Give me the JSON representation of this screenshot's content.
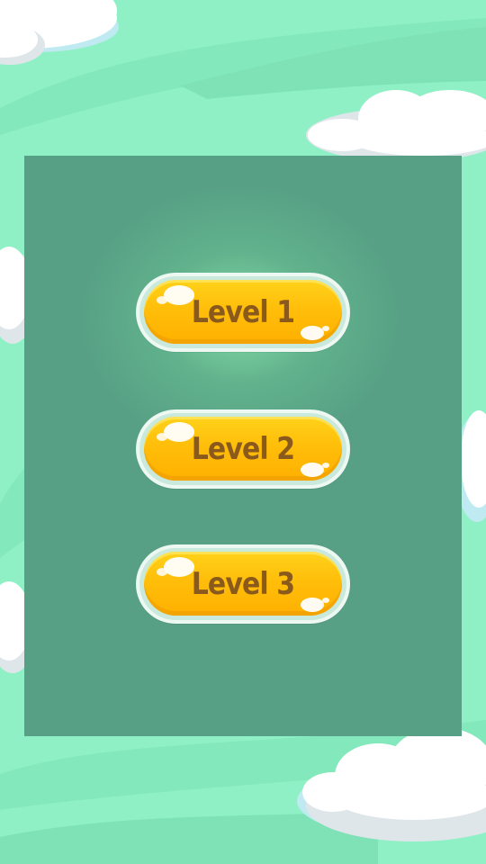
{
  "background": {
    "sky_color": "#8ff0c6",
    "stripe_color": "#7fe4b8",
    "cloud_color": "#ffffff",
    "cloud_shadow_color": "#dfe6ea",
    "cloud_outline_color": "#bfeaf2"
  },
  "panel": {
    "color": "#57a085",
    "glow_color": "#8ce6aa"
  },
  "level_buttons": [
    {
      "label": "Level 1"
    },
    {
      "label": "Level 2"
    },
    {
      "label": "Level 3"
    }
  ],
  "button_style": {
    "fill_color": "#ffc20e",
    "text_color": "#8a5a1c",
    "rim_color": "#eef8f2"
  }
}
